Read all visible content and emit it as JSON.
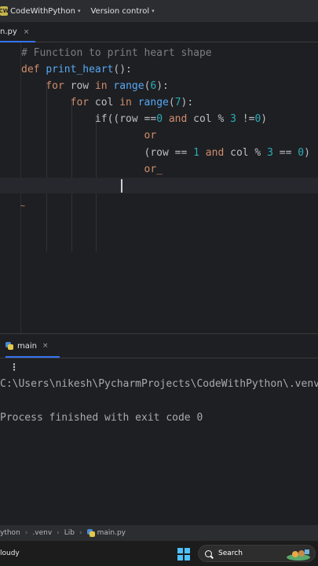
{
  "titlebar": {
    "project_badge": "CW",
    "project_name": "CodeWithPython",
    "version_control": "Version control"
  },
  "tabs": [
    {
      "label": "n.py",
      "close": "×"
    }
  ],
  "editor": {
    "lines": [
      {
        "tokens": [
          {
            "t": "# Function to print heart shape",
            "c": "cm"
          }
        ]
      },
      {
        "tokens": [
          {
            "t": "def ",
            "c": "kw"
          },
          {
            "t": "print_heart",
            "c": "fn"
          },
          {
            "t": "():",
            "c": "op"
          }
        ]
      },
      {
        "tokens": [
          {
            "t": "    for ",
            "c": "kw"
          },
          {
            "t": "row ",
            "c": "op"
          },
          {
            "t": "in ",
            "c": "kw"
          },
          {
            "t": "range",
            "c": "fn"
          },
          {
            "t": "(",
            "c": "op"
          },
          {
            "t": "6",
            "c": "num"
          },
          {
            "t": "):",
            "c": "op"
          }
        ]
      },
      {
        "tokens": [
          {
            "t": "        for ",
            "c": "kw"
          },
          {
            "t": "col ",
            "c": "op"
          },
          {
            "t": "in ",
            "c": "kw"
          },
          {
            "t": "range",
            "c": "fn"
          },
          {
            "t": "(",
            "c": "op"
          },
          {
            "t": "7",
            "c": "num"
          },
          {
            "t": "):",
            "c": "op"
          }
        ]
      },
      {
        "tokens": [
          {
            "t": "            if((row ==",
            "c": "op"
          },
          {
            "t": "0",
            "c": "num"
          },
          {
            "t": " and ",
            "c": "kw"
          },
          {
            "t": "col % ",
            "c": "op"
          },
          {
            "t": "3",
            "c": "num"
          },
          {
            "t": " !=",
            "c": "op"
          },
          {
            "t": "0",
            "c": "num"
          },
          {
            "t": ")",
            "c": "op"
          }
        ]
      },
      {
        "tokens": [
          {
            "t": "                    or",
            "c": "kw"
          }
        ]
      },
      {
        "tokens": [
          {
            "t": "                    (row == ",
            "c": "op"
          },
          {
            "t": "1",
            "c": "num"
          },
          {
            "t": " and ",
            "c": "kw"
          },
          {
            "t": "col % ",
            "c": "op"
          },
          {
            "t": "3",
            "c": "num"
          },
          {
            "t": " == ",
            "c": "op"
          },
          {
            "t": "0",
            "c": "num"
          },
          {
            "t": ")",
            "c": "op"
          }
        ]
      },
      {
        "tokens": [
          {
            "t": "                    or_",
            "c": "kw"
          }
        ]
      }
    ],
    "tilde": "~"
  },
  "run_panel": {
    "tab_label": "main",
    "tab_close": "×",
    "kebab": "⋮",
    "console": [
      "C:\\Users\\nikesh\\PycharmProjects\\CodeWithPython\\.venv",
      "",
      "Process finished with exit code 0"
    ]
  },
  "breadcrumb": [
    "ython",
    ".venv",
    "Lib",
    "main.py"
  ],
  "taskbar": {
    "weather": "loudy",
    "search_label": "Search"
  }
}
